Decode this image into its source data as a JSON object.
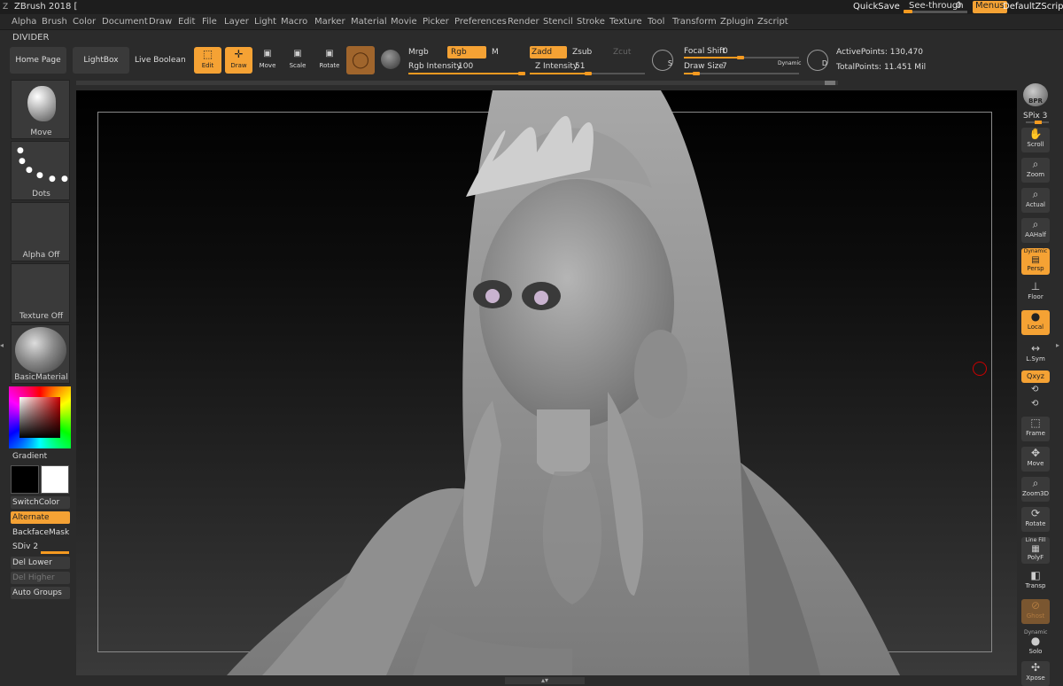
{
  "app": {
    "title": "ZBrush 2018 ["
  },
  "titlebar": {
    "quicksave": "QuickSave",
    "seethrough_label": "See-through",
    "seethrough_value": "0",
    "menus": "Menus",
    "script": "DefaultZScript"
  },
  "menus": [
    "Alpha",
    "Brush",
    "Color",
    "Document",
    "Draw",
    "Edit",
    "File",
    "Layer",
    "Light",
    "Macro",
    "Marker",
    "Material",
    "Movie",
    "Picker",
    "Preferences",
    "Render",
    "Stencil",
    "Stroke",
    "Texture",
    "Tool",
    "Transform",
    "Zplugin",
    "Zscript"
  ],
  "divider_label": "DIVIDER",
  "toolbar": {
    "home_page": "Home Page",
    "lightbox": "LightBox",
    "live_boolean": "Live Boolean",
    "edit": "Edit",
    "draw": "Draw",
    "move": "Move",
    "scale": "Scale",
    "rotate": "Rotate",
    "mrgb": "Mrgb",
    "rgb": "Rgb",
    "m": "M",
    "rgb_intensity_label": "Rgb Intensity",
    "rgb_intensity_value": "100",
    "zadd": "Zadd",
    "zsub": "Zsub",
    "zcut": "Zcut",
    "z_intensity_label": "Z Intensity",
    "z_intensity_value": "51",
    "focal_shift_label": "Focal Shift",
    "focal_shift_value": "0",
    "draw_size_label": "Draw Size",
    "draw_size_value": "7",
    "dynamic": "Dynamic",
    "active_points": "ActivePoints: 130,470",
    "total_points": "TotalPoints: 11.451 Mil"
  },
  "left": {
    "brush": "Move",
    "stroke": "Dots",
    "alpha": "Alpha Off",
    "texture": "Texture Off",
    "material": "BasicMaterial",
    "gradient": "Gradient",
    "switchcolor": "SwitchColor",
    "alternate": "Alternate",
    "backfacemask": "BackfaceMask",
    "sdiv": "SDiv 2",
    "del_lower": "Del Lower",
    "del_higher": "Del Higher",
    "auto_groups": "Auto Groups"
  },
  "right": {
    "bpr": "BPR",
    "spix": "SPix 3",
    "scroll": "Scroll",
    "zoom": "Zoom",
    "actual": "Actual",
    "aahalf": "AAHalf",
    "dynamic": "Dynamic",
    "persp": "Persp",
    "floor": "Floor",
    "local": "Local",
    "lsym": "L.Sym",
    "xyz": "Qxyz",
    "frame": "Frame",
    "move": "Move",
    "zoom3d": "Zoom3D",
    "rotate": "Rotate",
    "line_fill": "Line Fill",
    "polyf": "PolyF",
    "transp": "Transp",
    "ghost": "Ghost",
    "dynamic2": "Dynamic",
    "solo": "Solo",
    "xpose": "Xpose"
  }
}
